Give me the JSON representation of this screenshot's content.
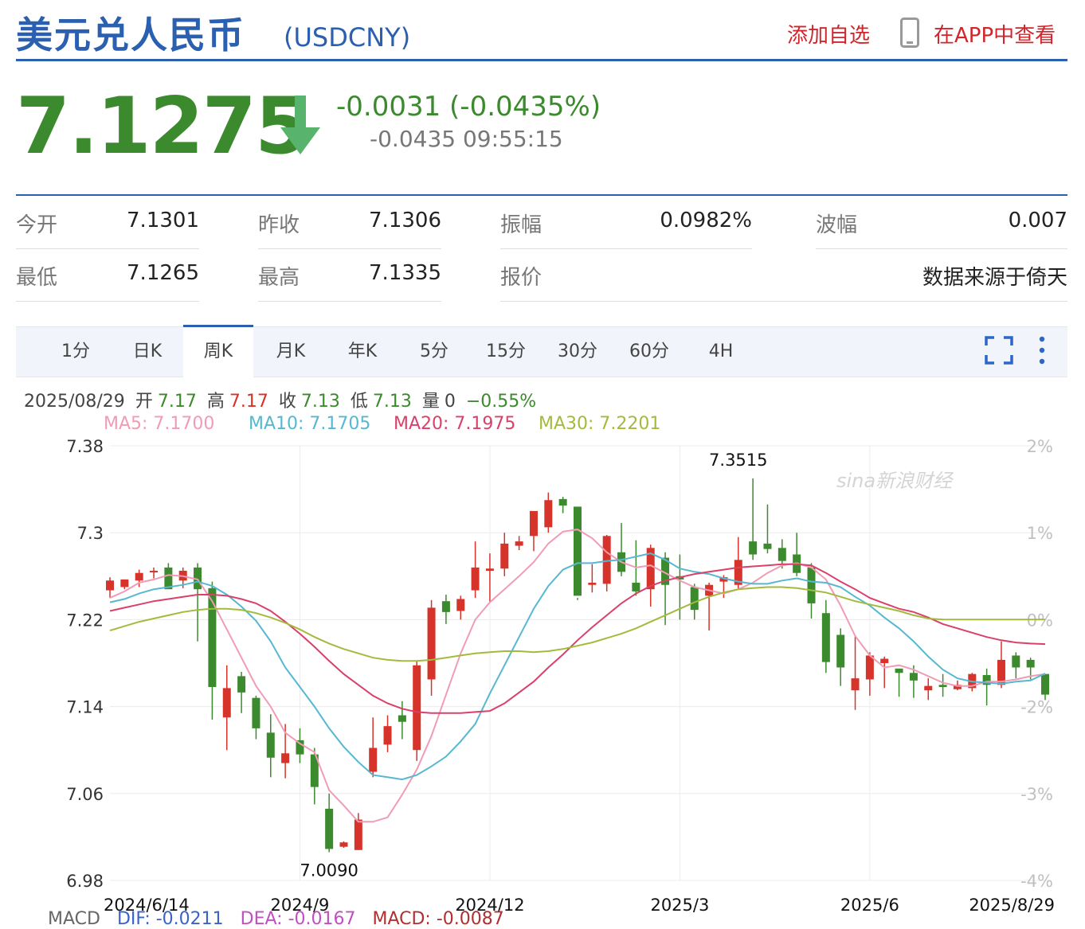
{
  "header": {
    "title": "美元兑人民币",
    "symbol": "(USDCNY)",
    "add_watch": "添加自选",
    "app_view": "在APP中查看"
  },
  "quote": {
    "price": "7.1275",
    "change": "-0.0031 (-0.0435%)",
    "sub_change": "-0.0435 09:55:15",
    "colors": {
      "up": "#d6332a",
      "down": "#3c8a2e",
      "accent": "#2b5fb0"
    }
  },
  "stats": [
    {
      "label": "今开",
      "value": "7.1301"
    },
    {
      "label": "昨收",
      "value": "7.1306"
    },
    {
      "label": "振幅",
      "value": "0.0982%"
    },
    {
      "label": "波幅",
      "value": "0.007"
    },
    {
      "label": "最低",
      "value": "7.1265"
    },
    {
      "label": "最高",
      "value": "7.1335"
    },
    {
      "label": "报价",
      "value": "数据来源于倚天"
    }
  ],
  "tabs": [
    "1分",
    "日K",
    "周K",
    "月K",
    "年K",
    "5分",
    "15分",
    "30分",
    "60分",
    "4H"
  ],
  "active_tab": "周K",
  "kline_info": {
    "date": "2025/08/29",
    "open_label": "开",
    "open": "7.17",
    "high_label": "高",
    "high": "7.17",
    "close_label": "收",
    "close": "7.13",
    "low_label": "低",
    "low": "7.13",
    "vol_label": "量",
    "vol": "0",
    "pct": "−0.55%"
  },
  "ma_legend": {
    "ma5": "MA5: 7.1700",
    "ma10": "MA10: 7.1705",
    "ma20": "MA20: 7.1975",
    "ma30": "MA30: 7.2201",
    "colors": {
      "ma5": "#f09cb5",
      "ma10": "#56b8d0",
      "ma20": "#d9406a",
      "ma30": "#a3bb3c"
    }
  },
  "macd_row": {
    "macd": "MACD",
    "dif": "DIF: -0.0211",
    "dea": "DEA: -0.0167",
    "macd_val": "MACD: -0.0087"
  },
  "watermark": "sina新浪财经",
  "chart_data": {
    "type": "candlestick",
    "period": "weekly",
    "ylim": [
      6.98,
      7.38
    ],
    "y_ticks": [
      7.38,
      7.3,
      7.22,
      7.14,
      7.06,
      6.98
    ],
    "y_tick_labels": [
      "7.38",
      "7.3",
      "7.22",
      "7.14",
      "7.06",
      "6.98"
    ],
    "pct_ticks": [
      "2%",
      "1%",
      "0%",
      "-2%",
      "-3%",
      "-4%"
    ],
    "x_labels": [
      {
        "text": "2024/6/14",
        "index": 0
      },
      {
        "text": "2024/9",
        "index": 13
      },
      {
        "text": "2024/12",
        "index": 26
      },
      {
        "text": "2025/3",
        "index": 39
      },
      {
        "text": "2025/6",
        "index": 52
      },
      {
        "text": "2025/8/29",
        "index": 63
      }
    ],
    "annotations": [
      {
        "text": "7.3515",
        "index": 43,
        "value": 7.3515
      },
      {
        "text": "7.0090",
        "index": 15,
        "value": 7.009
      }
    ],
    "candles": [
      {
        "o": 7.247,
        "h": 7.259,
        "l": 7.24,
        "c": 7.256
      },
      {
        "o": 7.25,
        "h": 7.257,
        "l": 7.248,
        "c": 7.257
      },
      {
        "o": 7.256,
        "h": 7.266,
        "l": 7.25,
        "c": 7.263
      },
      {
        "o": 7.264,
        "h": 7.268,
        "l": 7.258,
        "c": 7.265
      },
      {
        "o": 7.268,
        "h": 7.272,
        "l": 7.25,
        "c": 7.248
      },
      {
        "o": 7.256,
        "h": 7.268,
        "l": 7.249,
        "c": 7.265
      },
      {
        "o": 7.268,
        "h": 7.272,
        "l": 7.2,
        "c": 7.248
      },
      {
        "o": 7.249,
        "h": 7.255,
        "l": 7.128,
        "c": 7.158
      },
      {
        "o": 7.13,
        "h": 7.178,
        "l": 7.1,
        "c": 7.157
      },
      {
        "o": 7.168,
        "h": 7.172,
        "l": 7.134,
        "c": 7.153
      },
      {
        "o": 7.148,
        "h": 7.15,
        "l": 7.11,
        "c": 7.12
      },
      {
        "o": 7.116,
        "h": 7.133,
        "l": 7.075,
        "c": 7.093
      },
      {
        "o": 7.088,
        "h": 7.124,
        "l": 7.074,
        "c": 7.097
      },
      {
        "o": 7.109,
        "h": 7.12,
        "l": 7.088,
        "c": 7.096
      },
      {
        "o": 7.096,
        "h": 7.102,
        "l": 7.05,
        "c": 7.066
      },
      {
        "o": 7.046,
        "h": 7.06,
        "l": 7.006,
        "c": 7.009
      },
      {
        "o": 7.011,
        "h": 7.016,
        "l": 7.01,
        "c": 7.015
      },
      {
        "o": 7.008,
        "h": 7.042,
        "l": 7.008,
        "c": 7.036
      },
      {
        "o": 7.08,
        "h": 7.13,
        "l": 7.075,
        "c": 7.102
      },
      {
        "o": 7.105,
        "h": 7.132,
        "l": 7.098,
        "c": 7.122
      },
      {
        "o": 7.132,
        "h": 7.145,
        "l": 7.11,
        "c": 7.126
      },
      {
        "o": 7.1,
        "h": 7.182,
        "l": 7.09,
        "c": 7.178
      },
      {
        "o": 7.165,
        "h": 7.238,
        "l": 7.15,
        "c": 7.231
      },
      {
        "o": 7.237,
        "h": 7.243,
        "l": 7.216,
        "c": 7.227
      },
      {
        "o": 7.228,
        "h": 7.242,
        "l": 7.22,
        "c": 7.239
      },
      {
        "o": 7.247,
        "h": 7.292,
        "l": 7.24,
        "c": 7.268
      },
      {
        "o": 7.265,
        "h": 7.281,
        "l": 7.236,
        "c": 7.267
      },
      {
        "o": 7.267,
        "h": 7.3,
        "l": 7.26,
        "c": 7.29
      },
      {
        "o": 7.288,
        "h": 7.297,
        "l": 7.284,
        "c": 7.292
      },
      {
        "o": 7.297,
        "h": 7.305,
        "l": 7.283,
        "c": 7.32
      },
      {
        "o": 7.305,
        "h": 7.337,
        "l": 7.3,
        "c": 7.33
      },
      {
        "o": 7.331,
        "h": 7.333,
        "l": 7.318,
        "c": 7.325
      },
      {
        "o": 7.324,
        "h": 7.24,
        "l": 7.238,
        "c": 7.242
      },
      {
        "o": 7.252,
        "h": 7.271,
        "l": 7.245,
        "c": 7.254
      },
      {
        "o": 7.253,
        "h": 7.298,
        "l": 7.246,
        "c": 7.297
      },
      {
        "o": 7.282,
        "h": 7.309,
        "l": 7.26,
        "c": 7.264
      },
      {
        "o": 7.254,
        "h": 7.293,
        "l": 7.242,
        "c": 7.246
      },
      {
        "o": 7.248,
        "h": 7.289,
        "l": 7.232,
        "c": 7.286
      },
      {
        "o": 7.277,
        "h": 7.282,
        "l": 7.215,
        "c": 7.252
      },
      {
        "o": 7.26,
        "h": 7.28,
        "l": 7.22,
        "c": 7.257
      },
      {
        "o": 7.25,
        "h": 7.253,
        "l": 7.22,
        "c": 7.229
      },
      {
        "o": 7.242,
        "h": 7.254,
        "l": 7.21,
        "c": 7.252
      },
      {
        "o": 7.255,
        "h": 7.261,
        "l": 7.24,
        "c": 7.259
      },
      {
        "o": 7.252,
        "h": 7.296,
        "l": 7.248,
        "c": 7.275
      },
      {
        "o": 7.292,
        "h": 7.35,
        "l": 7.275,
        "c": 7.28
      },
      {
        "o": 7.29,
        "h": 7.326,
        "l": 7.281,
        "c": 7.285
      },
      {
        "o": 7.286,
        "h": 7.294,
        "l": 7.267,
        "c": 7.274
      },
      {
        "o": 7.28,
        "h": 7.3,
        "l": 7.26,
        "c": 7.263
      },
      {
        "o": 7.268,
        "h": 7.272,
        "l": 7.221,
        "c": 7.235
      },
      {
        "o": 7.226,
        "h": 7.238,
        "l": 7.171,
        "c": 7.181
      },
      {
        "o": 7.206,
        "h": 7.212,
        "l": 7.159,
        "c": 7.176
      },
      {
        "o": 7.155,
        "h": 7.205,
        "l": 7.137,
        "c": 7.166
      },
      {
        "o": 7.165,
        "h": 7.19,
        "l": 7.15,
        "c": 7.187
      },
      {
        "o": 7.18,
        "h": 7.186,
        "l": 7.157,
        "c": 7.184
      },
      {
        "o": 7.175,
        "h": 7.172,
        "l": 7.149,
        "c": 7.171
      },
      {
        "o": 7.171,
        "h": 7.178,
        "l": 7.148,
        "c": 7.164
      },
      {
        "o": 7.155,
        "h": 7.166,
        "l": 7.146,
        "c": 7.159
      },
      {
        "o": 7.16,
        "h": 7.17,
        "l": 7.149,
        "c": 7.158
      },
      {
        "o": 7.156,
        "h": 7.164,
        "l": 7.155,
        "c": 7.16
      },
      {
        "o": 7.157,
        "h": 7.171,
        "l": 7.154,
        "c": 7.17
      },
      {
        "o": 7.169,
        "h": 7.175,
        "l": 7.141,
        "c": 7.16
      },
      {
        "o": 7.16,
        "h": 7.2,
        "l": 7.157,
        "c": 7.183
      },
      {
        "o": 7.187,
        "h": 7.19,
        "l": 7.166,
        "c": 7.176
      },
      {
        "o": 7.183,
        "h": 7.185,
        "l": 7.165,
        "c": 7.176
      },
      {
        "o": 7.17,
        "h": 7.17,
        "l": 7.146,
        "c": 7.151
      }
    ],
    "series": [
      {
        "name": "MA5",
        "values": [
          7.24,
          7.246,
          7.254,
          7.257,
          7.261,
          7.26,
          7.257,
          7.237,
          7.211,
          7.185,
          7.159,
          7.14,
          7.116,
          7.106,
          7.098,
          7.063,
          7.049,
          7.034,
          7.034,
          7.038,
          7.059,
          7.082,
          7.113,
          7.151,
          7.189,
          7.22,
          7.236,
          7.248,
          7.26,
          7.273,
          7.29,
          7.301,
          7.303,
          7.295,
          7.282,
          7.273,
          7.268,
          7.27,
          7.263,
          7.256,
          7.25,
          7.247,
          7.244,
          7.248,
          7.254,
          7.263,
          7.27,
          7.272,
          7.268,
          7.257,
          7.233,
          7.205,
          7.187,
          7.176,
          7.178,
          7.174,
          7.168,
          7.162,
          7.159,
          7.159,
          7.163,
          7.163,
          7.165,
          7.168,
          7.17
        ]
      },
      {
        "name": "MA10",
        "values": [
          7.236,
          7.239,
          7.244,
          7.248,
          7.25,
          7.252,
          7.255,
          7.251,
          7.243,
          7.232,
          7.219,
          7.2,
          7.176,
          7.158,
          7.14,
          7.12,
          7.103,
          7.089,
          7.077,
          7.075,
          7.073,
          7.077,
          7.085,
          7.094,
          7.108,
          7.124,
          7.152,
          7.178,
          7.204,
          7.23,
          7.251,
          7.266,
          7.272,
          7.272,
          7.274,
          7.275,
          7.278,
          7.281,
          7.275,
          7.267,
          7.264,
          7.262,
          7.258,
          7.255,
          7.253,
          7.253,
          7.256,
          7.258,
          7.255,
          7.254,
          7.25,
          7.241,
          7.233,
          7.222,
          7.212,
          7.2,
          7.186,
          7.174,
          7.166,
          7.163,
          7.162,
          7.161,
          7.163,
          7.164,
          7.1705
        ]
      },
      {
        "name": "MA20",
        "values": [
          7.228,
          7.231,
          7.234,
          7.237,
          7.239,
          7.241,
          7.243,
          7.243,
          7.242,
          7.239,
          7.235,
          7.228,
          7.218,
          7.207,
          7.195,
          7.182,
          7.17,
          7.16,
          7.15,
          7.143,
          7.138,
          7.135,
          7.134,
          7.134,
          7.134,
          7.135,
          7.136,
          7.143,
          7.153,
          7.163,
          7.176,
          7.188,
          7.201,
          7.213,
          7.224,
          7.235,
          7.244,
          7.251,
          7.256,
          7.259,
          7.262,
          7.264,
          7.266,
          7.268,
          7.269,
          7.27,
          7.271,
          7.271,
          7.27,
          7.263,
          7.255,
          7.248,
          7.24,
          7.235,
          7.23,
          7.227,
          7.222,
          7.216,
          7.212,
          7.208,
          7.204,
          7.201,
          7.199,
          7.198,
          7.1975
        ]
      },
      {
        "name": "MA30",
        "values": [
          7.21,
          7.214,
          7.218,
          7.221,
          7.224,
          7.227,
          7.229,
          7.23,
          7.23,
          7.229,
          7.226,
          7.222,
          7.217,
          7.211,
          7.204,
          7.198,
          7.193,
          7.189,
          7.185,
          7.183,
          7.182,
          7.182,
          7.183,
          7.185,
          7.187,
          7.189,
          7.19,
          7.191,
          7.191,
          7.19,
          7.191,
          7.193,
          7.196,
          7.199,
          7.203,
          7.207,
          7.212,
          7.218,
          7.224,
          7.23,
          7.236,
          7.241,
          7.245,
          7.248,
          7.249,
          7.25,
          7.25,
          7.249,
          7.247,
          7.245,
          7.241,
          7.237,
          7.234,
          7.231,
          7.228,
          7.224,
          7.221,
          7.2201,
          7.2201,
          7.2201,
          7.2201,
          7.2201,
          7.2201,
          7.2201,
          7.2201
        ]
      }
    ]
  }
}
